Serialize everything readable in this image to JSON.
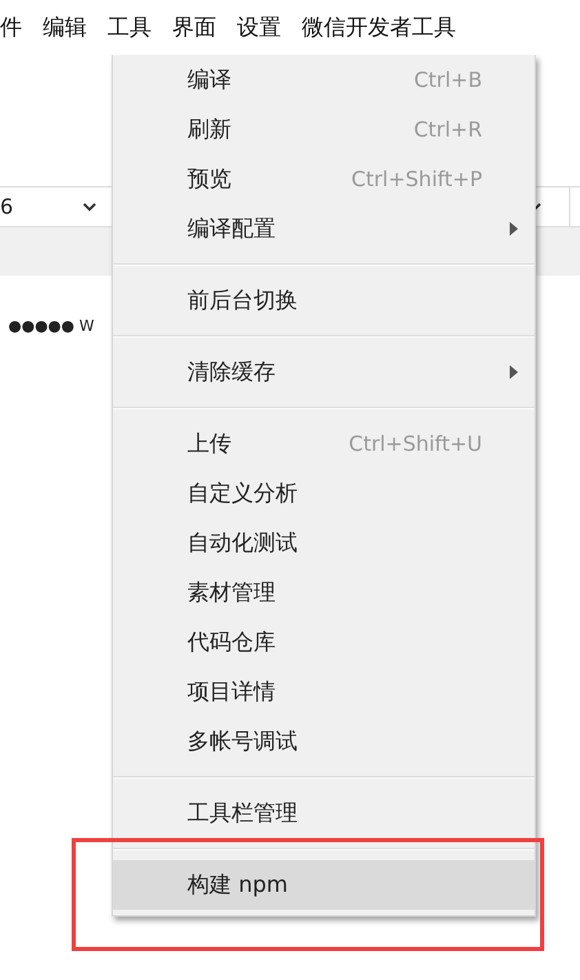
{
  "menubar": [
    "件",
    "编辑",
    "工具",
    "界面",
    "设置",
    "微信开发者工具"
  ],
  "toolbar": {
    "select_value": "6"
  },
  "status_text": "●●●●● W",
  "menu": {
    "groups": [
      [
        {
          "label": "编译",
          "shortcut": "Ctrl+B",
          "submenu": false,
          "selected": false
        },
        {
          "label": "刷新",
          "shortcut": "Ctrl+R",
          "submenu": false,
          "selected": false
        },
        {
          "label": "预览",
          "shortcut": "Ctrl+Shift+P",
          "submenu": false,
          "selected": false
        },
        {
          "label": "编译配置",
          "submenu": true,
          "selected": false
        }
      ],
      [
        {
          "label": "前后台切换",
          "submenu": false,
          "selected": false
        }
      ],
      [
        {
          "label": "清除缓存",
          "submenu": true,
          "selected": false
        }
      ],
      [
        {
          "label": "上传",
          "shortcut": "Ctrl+Shift+U",
          "submenu": false,
          "selected": false
        },
        {
          "label": "自定义分析",
          "submenu": false,
          "selected": false
        },
        {
          "label": "自动化测试",
          "submenu": false,
          "selected": false
        },
        {
          "label": "素材管理",
          "submenu": false,
          "selected": false
        },
        {
          "label": "代码仓库",
          "submenu": false,
          "selected": false
        },
        {
          "label": "项目详情",
          "submenu": false,
          "selected": false
        },
        {
          "label": "多帐号调试",
          "submenu": false,
          "selected": false
        }
      ],
      [
        {
          "label": "工具栏管理",
          "submenu": false,
          "selected": false
        }
      ],
      [
        {
          "label": "构建 npm",
          "submenu": false,
          "selected": true
        }
      ]
    ]
  }
}
